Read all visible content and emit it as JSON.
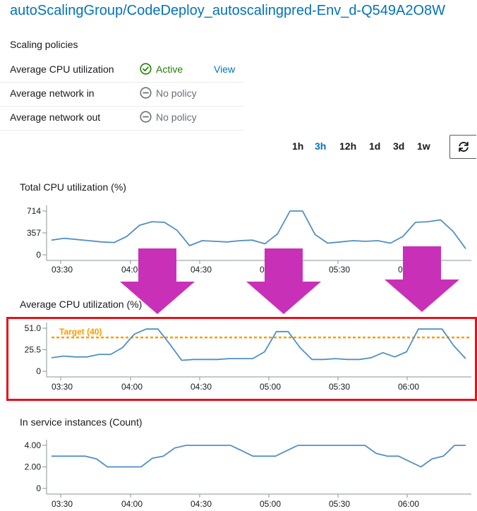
{
  "header": {
    "title": "autoScalingGroup/CodeDeploy_autoscalingpred-Env_d-Q549A2O8W"
  },
  "scaling": {
    "section_label": "Scaling policies",
    "policies": [
      {
        "name": "Average CPU utilization",
        "status": "Active",
        "status_icon": "check-circle-icon",
        "action": "View"
      },
      {
        "name": "Average network in",
        "status": "No policy",
        "status_icon": "minus-circle-icon"
      },
      {
        "name": "Average network out",
        "status": "No policy",
        "status_icon": "minus-circle-icon"
      }
    ]
  },
  "time_range": {
    "options": [
      "1h",
      "3h",
      "12h",
      "1d",
      "3d",
      "1w"
    ],
    "selected": "3h",
    "refresh_icon": "refresh-icon"
  },
  "colors": {
    "line": "#4f8fc8",
    "target": "#ff9900",
    "link": "#0073bb",
    "active": "#1d8102",
    "arrow": "#c930b8",
    "highlight": "#e8101a"
  },
  "chart_data": [
    {
      "type": "line",
      "title": "Total CPU utilization (%)",
      "yticks": [
        "714",
        "357",
        "0"
      ],
      "ylim": [
        0,
        714
      ],
      "xticks": [
        "03:30",
        "04:00",
        "04:30",
        "05:00",
        "05:30",
        "06:00"
      ],
      "x": [
        0,
        1,
        2,
        3,
        4,
        5,
        6,
        7,
        8,
        9,
        10,
        11,
        12,
        13,
        14,
        15,
        16,
        17,
        18,
        19,
        20,
        21,
        22,
        23,
        24,
        25,
        26,
        27,
        28,
        29,
        30
      ],
      "values": [
        240,
        270,
        250,
        230,
        210,
        200,
        300,
        480,
        540,
        530,
        400,
        150,
        230,
        220,
        210,
        230,
        240,
        180,
        340,
        720,
        720,
        330,
        190,
        210,
        230,
        220,
        230,
        190,
        300,
        530,
        540,
        570,
        380,
        100
      ],
      "grid": false
    },
    {
      "type": "line",
      "title": "Average CPU utilization (%)",
      "yticks": [
        "51.0",
        "25.5",
        "0"
      ],
      "ylim": [
        0,
        51
      ],
      "xticks": [
        "03:30",
        "04:00",
        "04:30",
        "05:00",
        "05:30",
        "06:00"
      ],
      "target_label": "Target (40)",
      "target": 40,
      "values": [
        16,
        18,
        17,
        17,
        20,
        20,
        28,
        44,
        50,
        50,
        32,
        13,
        14,
        14,
        14,
        15,
        15,
        15,
        23,
        47,
        47,
        28,
        14,
        14,
        15,
        14,
        14,
        16,
        22,
        17,
        23,
        50,
        50,
        50,
        30,
        15
      ],
      "grid": false
    },
    {
      "type": "line",
      "title": "In service instances (Count)",
      "yticks": [
        "4.00",
        "2.00",
        "0"
      ],
      "ylim": [
        0,
        4
      ],
      "xticks": [
        "03:30",
        "04:00",
        "04:30",
        "05:00",
        "05:30",
        "06:00"
      ],
      "values": [
        3,
        3,
        3,
        3,
        2.75,
        2,
        2,
        2,
        2,
        2.8,
        3,
        3.75,
        4,
        4,
        4,
        4,
        4,
        3.5,
        3,
        3,
        3,
        3.5,
        4,
        4,
        4,
        4,
        4,
        4,
        4,
        3.25,
        3,
        3,
        2.5,
        2,
        2.75,
        3,
        4,
        4
      ],
      "grid": false
    }
  ]
}
